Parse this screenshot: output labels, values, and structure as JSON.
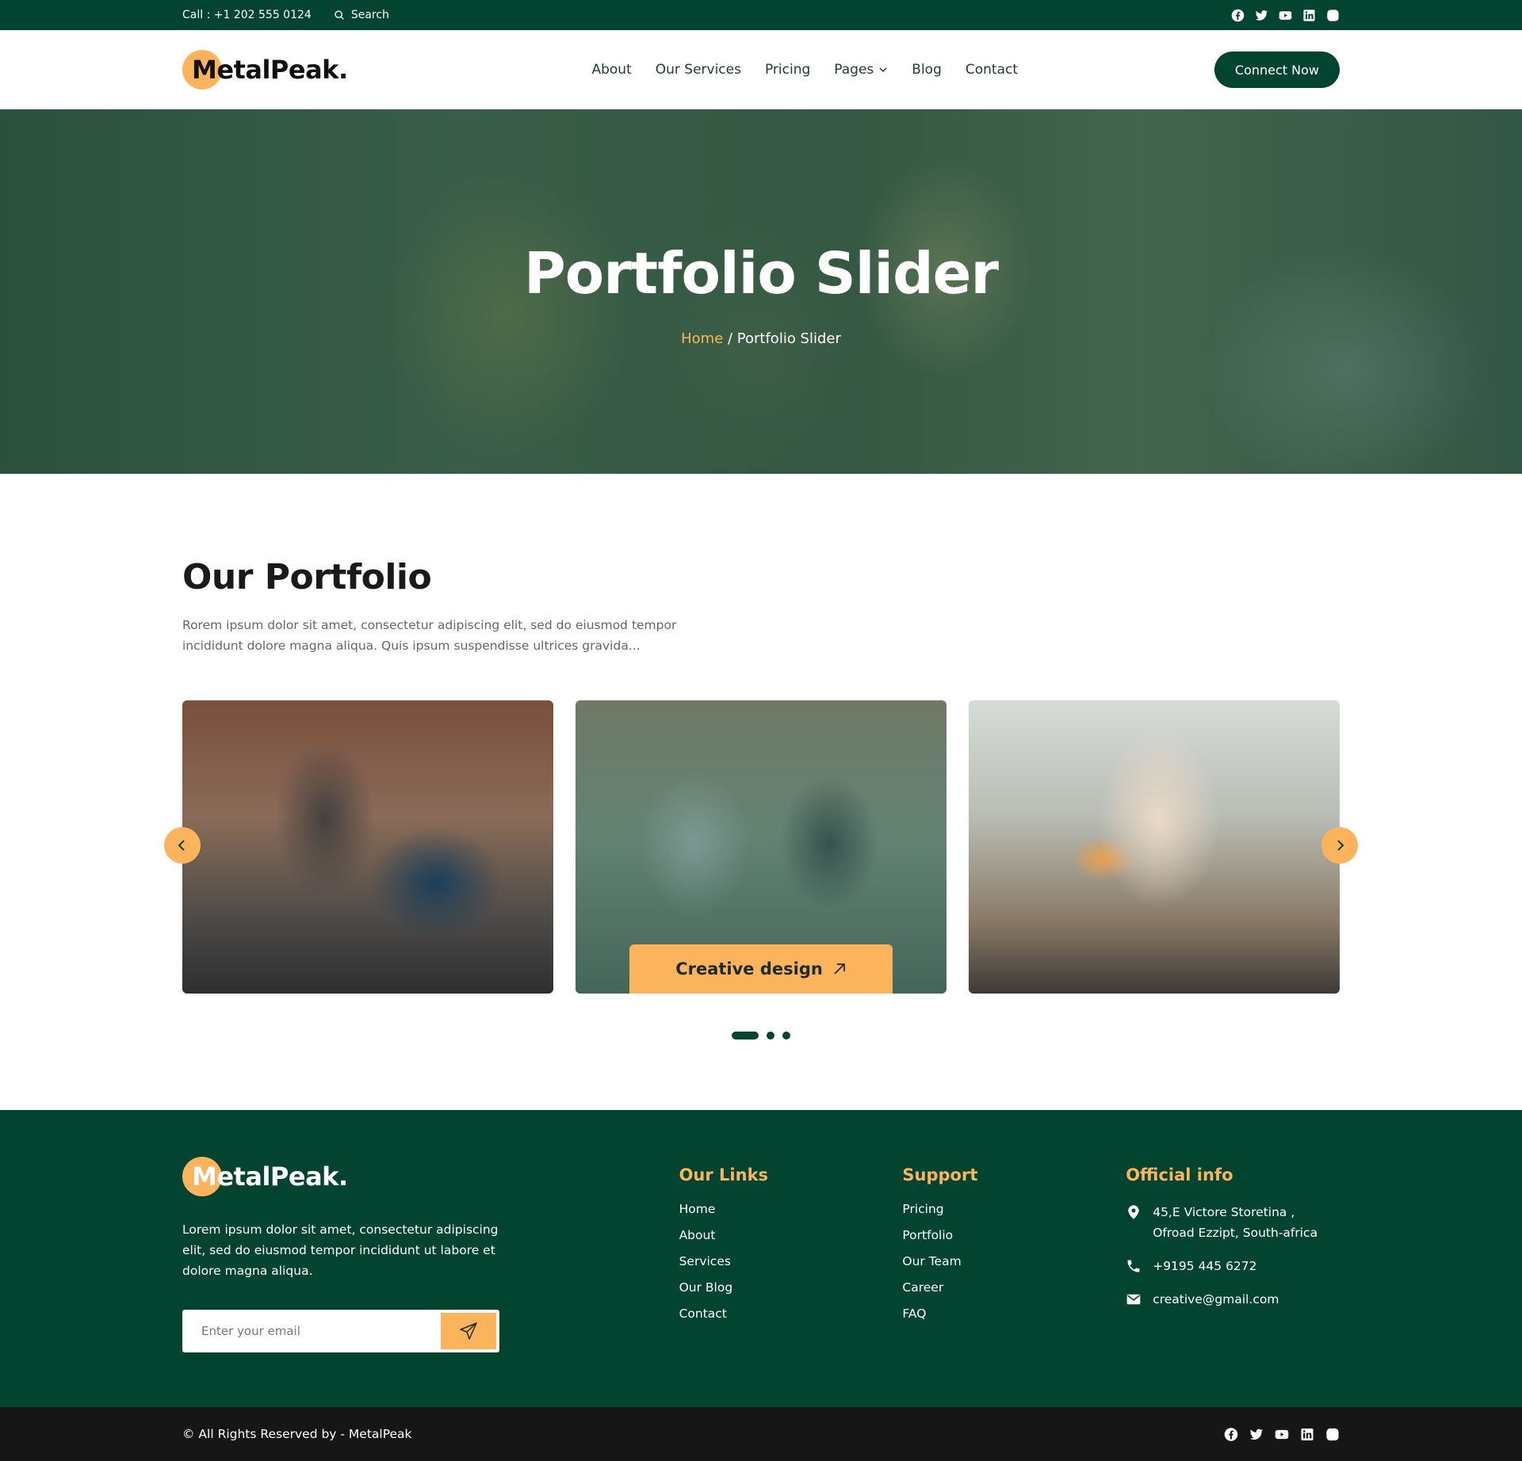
{
  "topbar": {
    "call": "Call : +1 202 555 0124",
    "search_label": "Search"
  },
  "logo": {
    "text": "MetalPeak."
  },
  "nav": {
    "about": "About",
    "services": "Our Services",
    "pricing": "Pricing",
    "pages": "Pages",
    "blog": "Blog",
    "contact": "Contact"
  },
  "cta": "Connect Now",
  "hero": {
    "title": "Portfolio Slider",
    "crumb_home": "Home",
    "crumb_sep": " / ",
    "crumb_current": "Portfolio Slider"
  },
  "portfolio": {
    "title": "Our Portfolio",
    "description": "Rorem ipsum dolor sit amet, consectetur adipiscing elit, sed do eiusmod tempor incididunt dolore magna aliqua. Quis ipsum suspendisse ultrices gravida...",
    "card_label": "Creative design"
  },
  "footer": {
    "description": "Lorem ipsum dolor sit amet, consectetur adipiscing elit, sed do eiusmod tempor incididunt ut labore et dolore magna aliqua.",
    "email_placeholder": "Enter your email",
    "links": {
      "title": "Our Links",
      "items": [
        "Home",
        "About",
        "Services",
        "Our Blog",
        "Contact"
      ]
    },
    "support": {
      "title": "Support",
      "items": [
        "Pricing",
        "Portfolio",
        "Our Team",
        "Career",
        "FAQ"
      ]
    },
    "info": {
      "title": "Official info",
      "address": "45,E Victore Storetina , Ofroad Ezzipt, South-africa",
      "phone": "+9195 445 6272",
      "email": "creative@gmail.com"
    }
  },
  "bottom": {
    "copyright": "© All Rights Reserved by - MetalPeak"
  },
  "colors": {
    "primary": "#02442f",
    "accent": "#fbb45c",
    "dark": "#161616"
  },
  "icons": [
    "search-icon",
    "facebook-icon",
    "twitter-icon",
    "youtube-icon",
    "linkedin-icon",
    "instagram-icon",
    "chevron-down-icon",
    "arrow-up-right-icon",
    "chevron-left-icon",
    "chevron-right-icon",
    "send-icon",
    "location-icon",
    "phone-icon",
    "mail-icon"
  ]
}
